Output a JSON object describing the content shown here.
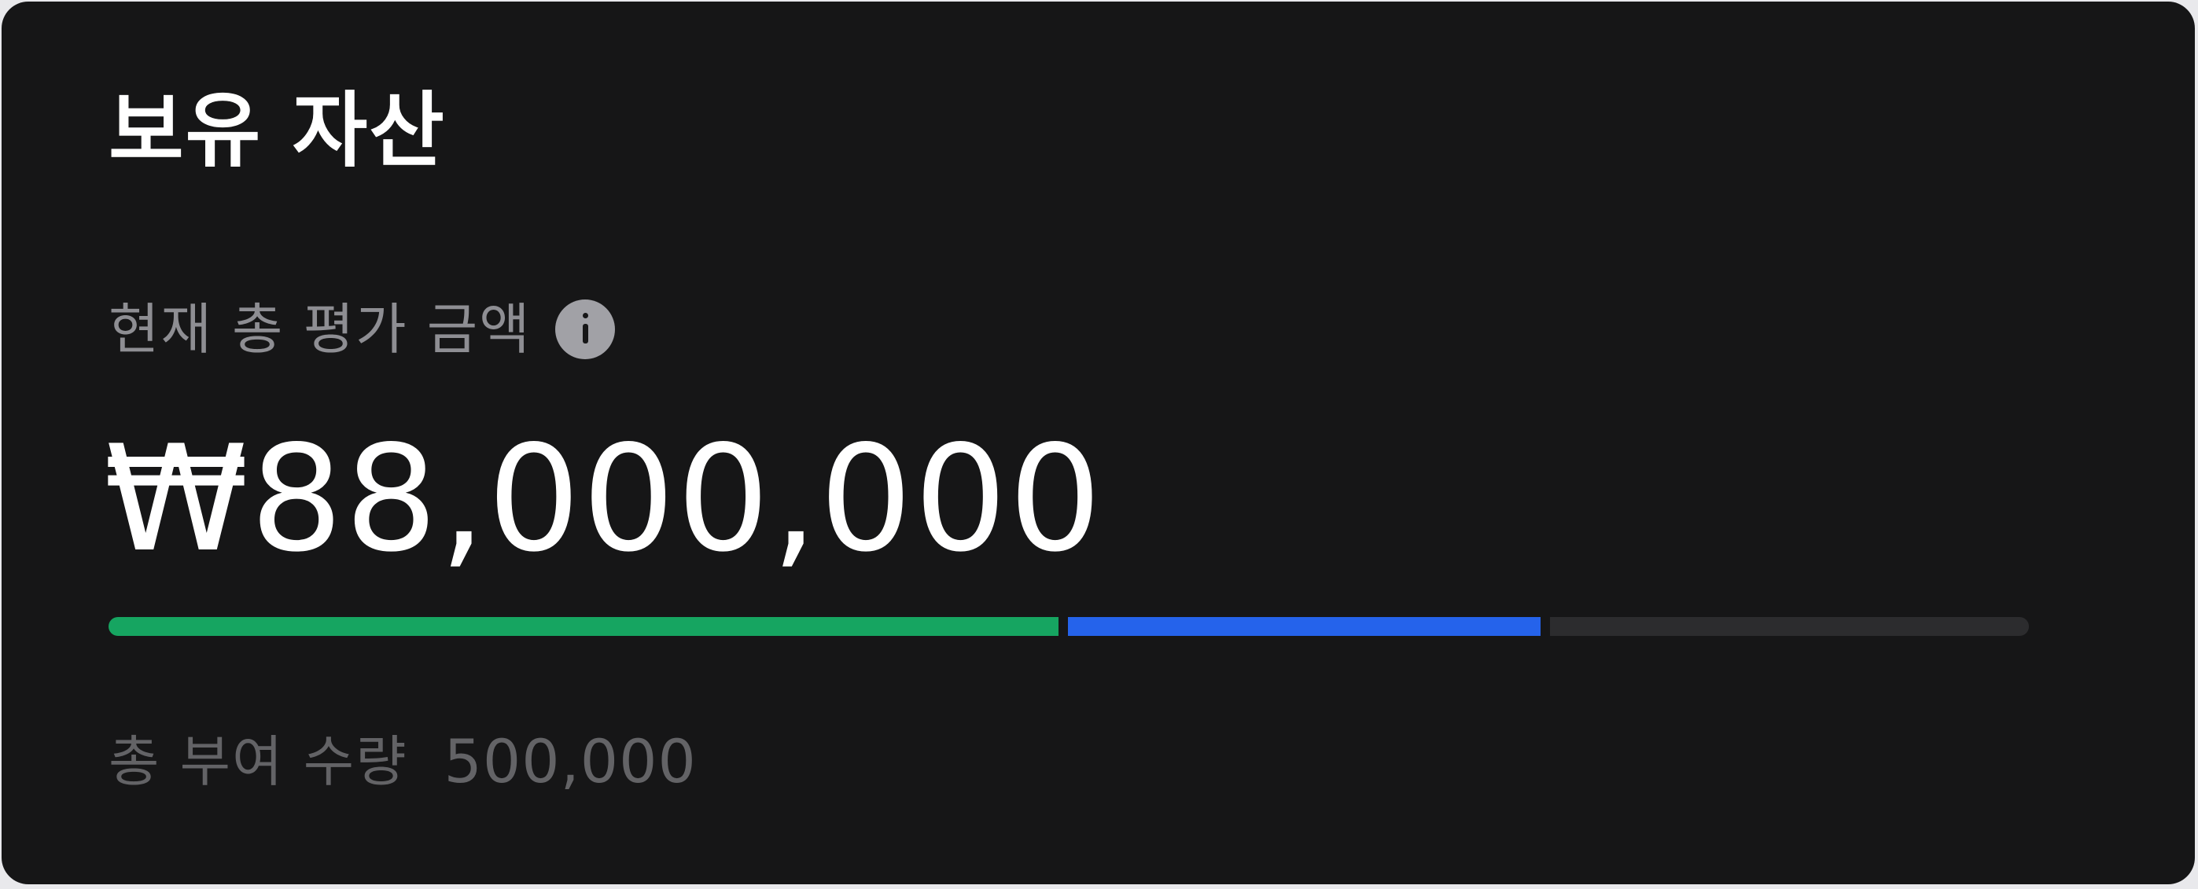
{
  "card": {
    "title": "보유 자산",
    "valuation_label": "현재 총 평가 금액",
    "info_icon": "info-icon",
    "total_value": "₩88,000,000",
    "progress": {
      "segments": [
        {
          "name": "green",
          "fraction": 0.4995,
          "color": "#16a561"
        },
        {
          "name": "blue",
          "fraction": 0.2486,
          "color": "#2563eb"
        },
        {
          "name": "remaining",
          "fraction": 0.2519,
          "color": "#2c2c2e"
        }
      ]
    },
    "grant_label": "총 부여 수량",
    "grant_value": "500,000"
  }
}
